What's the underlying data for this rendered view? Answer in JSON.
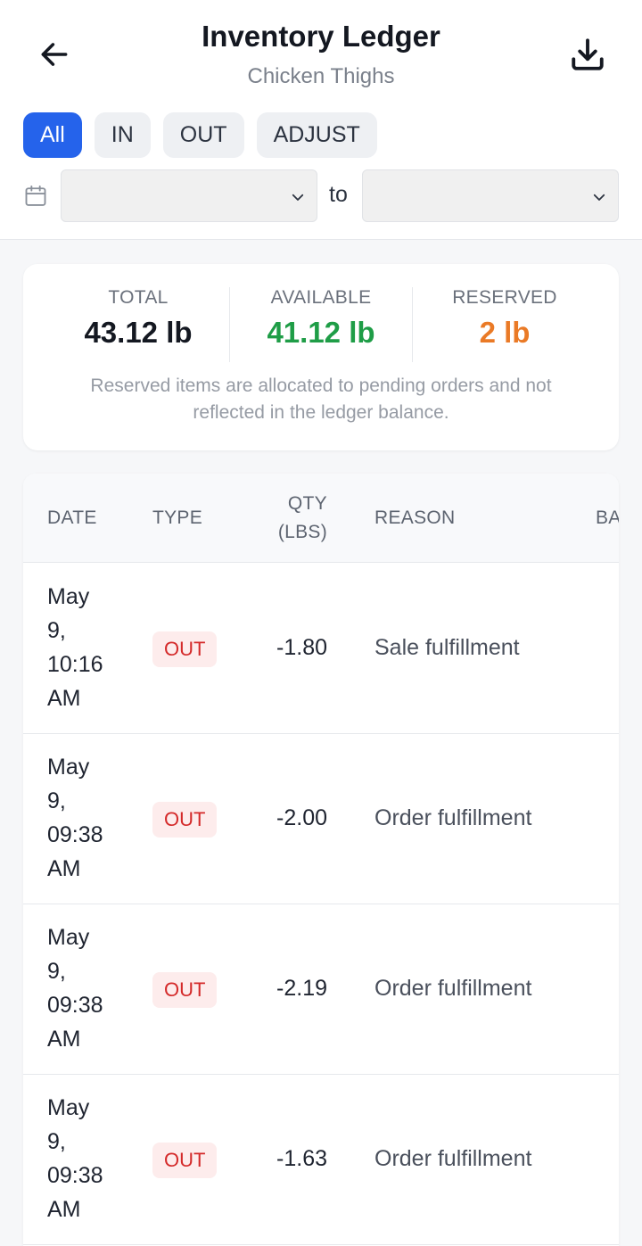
{
  "header": {
    "title": "Inventory Ledger",
    "subtitle": "Chicken Thighs"
  },
  "filters": [
    "All",
    "IN",
    "OUT",
    "ADJUST"
  ],
  "active_filter": "All",
  "date_range": {
    "from": "",
    "to": "",
    "separator": "to"
  },
  "summary": {
    "total_label": "TOTAL",
    "total_value": "43.12 lb",
    "available_label": "AVAILABLE",
    "available_value": "41.12 lb",
    "reserved_label": "RESERVED",
    "reserved_value": "2 lb",
    "note": "Reserved items are allocated to pending orders and not reflected in the ledger balance."
  },
  "table": {
    "columns": {
      "date": "DATE",
      "type": "TYPE",
      "qty_line1": "QTY",
      "qty_line2": "(LBS)",
      "reason": "REASON",
      "balance": "BA"
    },
    "rows": [
      {
        "date_lines": [
          "May",
          "9,",
          "10:16",
          "AM"
        ],
        "type": "OUT",
        "qty": "-1.80",
        "reason": "Sale fulfillment"
      },
      {
        "date_lines": [
          "May",
          "9,",
          "09:38",
          "AM"
        ],
        "type": "OUT",
        "qty": "-2.00",
        "reason": "Order fulfillment"
      },
      {
        "date_lines": [
          "May",
          "9,",
          "09:38",
          "AM"
        ],
        "type": "OUT",
        "qty": "-2.19",
        "reason": "Order fulfillment"
      },
      {
        "date_lines": [
          "May",
          "9,",
          "09:38",
          "AM"
        ],
        "type": "OUT",
        "qty": "-1.63",
        "reason": "Order fulfillment"
      }
    ]
  },
  "colors": {
    "accent": "#2563eb",
    "available": "#1f9d47",
    "reserved": "#ea7a26",
    "out_badge_text": "#d42a2a",
    "out_badge_bg": "#fdecec"
  },
  "icons": {
    "back": "arrow-left-icon",
    "download": "download-icon",
    "calendar": "calendar-icon",
    "dropdown": "chevron-down-icon"
  }
}
